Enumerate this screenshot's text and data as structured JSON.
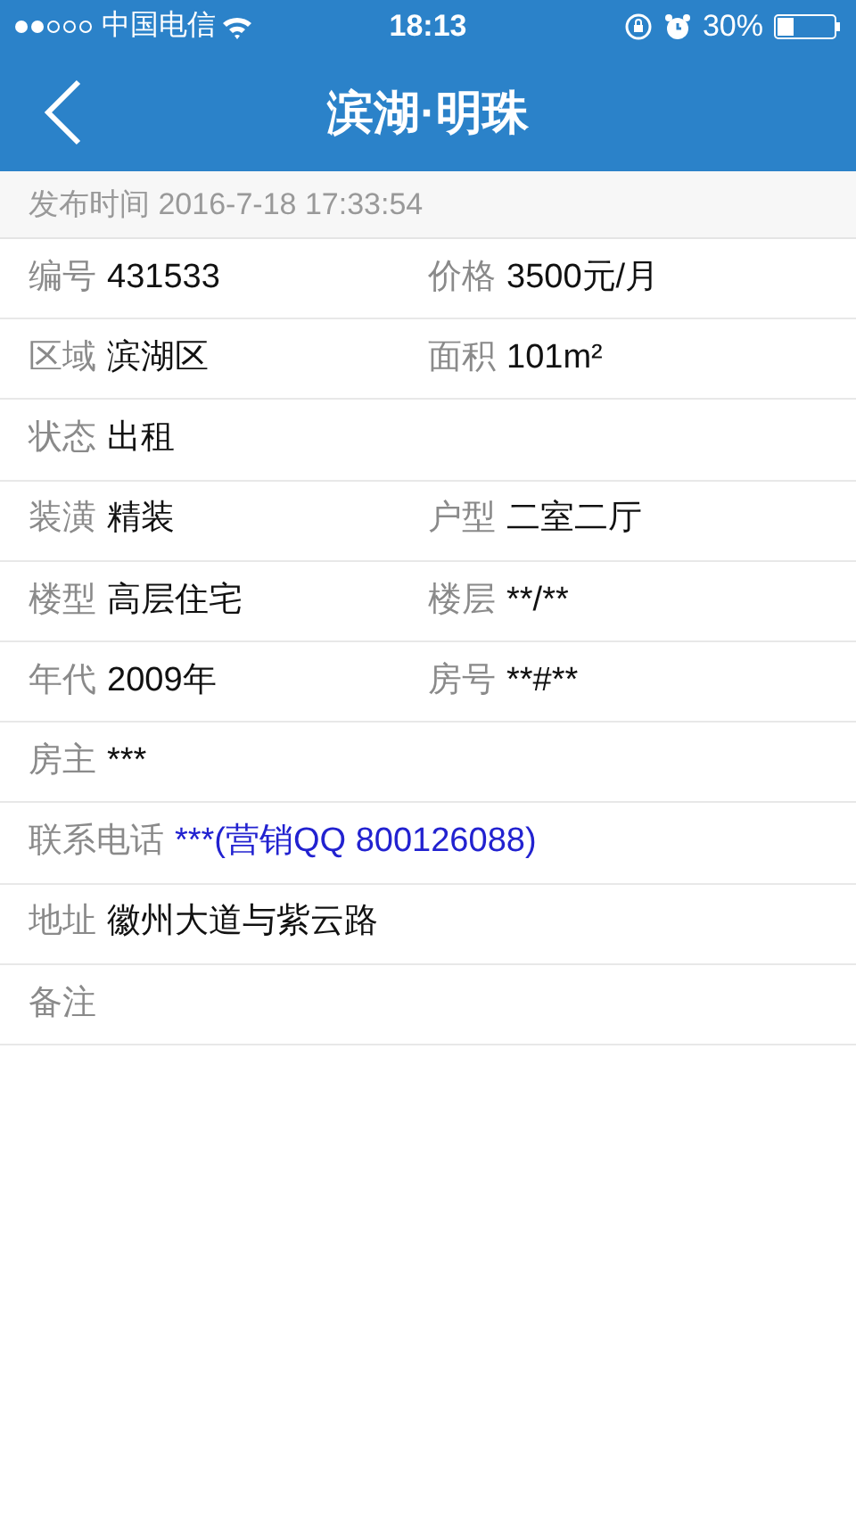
{
  "status_bar": {
    "carrier": "中国电信",
    "time": "18:13",
    "battery": "30%"
  },
  "nav_bar": {
    "title": "滨湖·明珠"
  },
  "published": {
    "label": "发布时间",
    "value": "2016-7-18 17:33:54"
  },
  "rows": [
    {
      "cells": [
        {
          "label": "编号",
          "value": "431533",
          "kind": "text"
        },
        {
          "label": "价格",
          "value": "3500元/月",
          "kind": "text"
        }
      ]
    },
    {
      "cells": [
        {
          "label": "区域",
          "value": "滨湖区",
          "kind": "text"
        },
        {
          "label": "面积",
          "value": "101m²",
          "kind": "text"
        }
      ]
    },
    {
      "cells": [
        {
          "label": "状态",
          "value": "出租",
          "kind": "text"
        }
      ]
    },
    {
      "cells": [
        {
          "label": "装潢",
          "value": "精装",
          "kind": "text"
        },
        {
          "label": "户型",
          "value": "二室二厅",
          "kind": "text"
        }
      ]
    },
    {
      "cells": [
        {
          "label": "楼型",
          "value": "高层住宅",
          "kind": "text"
        },
        {
          "label": "楼层",
          "value": "**/**",
          "kind": "text"
        }
      ]
    },
    {
      "cells": [
        {
          "label": "年代",
          "value": "2009年",
          "kind": "text"
        },
        {
          "label": "房号",
          "value": "**#**",
          "kind": "text"
        }
      ]
    },
    {
      "cells": [
        {
          "label": "房主",
          "value": "***",
          "kind": "text"
        }
      ]
    },
    {
      "cells": [
        {
          "label": "联系电话",
          "value": "***(营销QQ 800126088)",
          "kind": "link"
        }
      ]
    },
    {
      "cells": [
        {
          "label": "地址",
          "value": "徽州大道与紫云路",
          "kind": "text"
        }
      ]
    },
    {
      "cells": [
        {
          "label": "备注"
        }
      ]
    }
  ]
}
